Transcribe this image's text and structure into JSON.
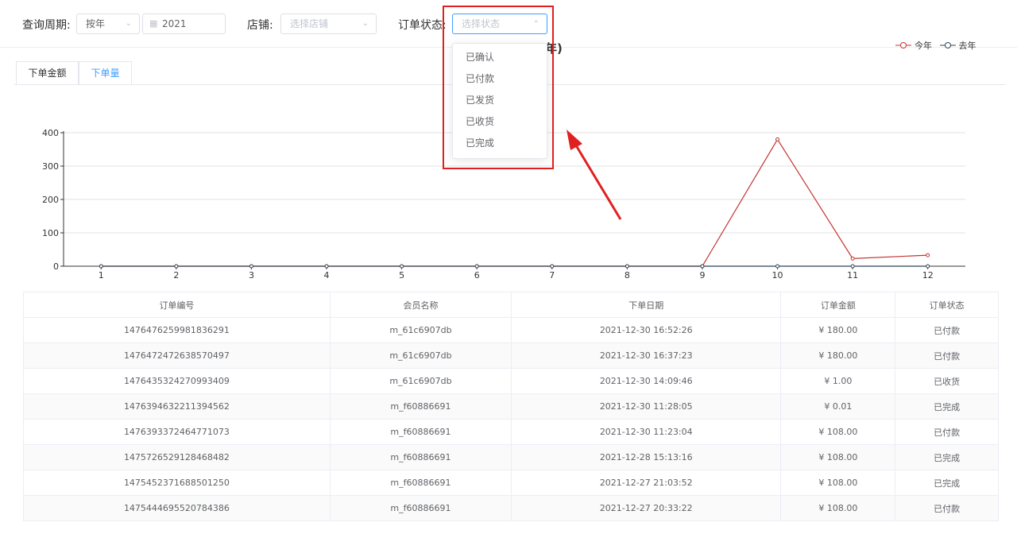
{
  "filters": {
    "period_label": "查询周期:",
    "period_value": "按年",
    "year_value": "2021",
    "shop_label": "店铺:",
    "shop_placeholder": "选择店铺",
    "status_label": "订单状态:",
    "status_placeholder": "选择状态"
  },
  "tabs": [
    {
      "label": "下单金额"
    },
    {
      "label": "下单量"
    }
  ],
  "chart_title_visible": "年)",
  "status_options": [
    "已确认",
    "已付款",
    "已发货",
    "已收货",
    "已完成"
  ],
  "chart_data": {
    "type": "line",
    "x": [
      "1",
      "2",
      "3",
      "4",
      "5",
      "6",
      "7",
      "8",
      "9",
      "10",
      "11",
      "12"
    ],
    "series": [
      {
        "name": "今年",
        "values": [
          0,
          0,
          0,
          0,
          0,
          0,
          0,
          0,
          0,
          380,
          23,
          33
        ],
        "color": "#c23531"
      },
      {
        "name": "去年",
        "values": [
          0,
          0,
          0,
          0,
          0,
          0,
          0,
          0,
          0,
          0,
          0,
          0
        ],
        "color": "#2f4554"
      }
    ],
    "yticks": [
      "0",
      "100",
      "200",
      "300",
      "400"
    ],
    "ylim": [
      0,
      400
    ],
    "legend": "top-right",
    "grid": true
  },
  "table": {
    "headers": [
      "订单编号",
      "会员名称",
      "下单日期",
      "订单金额",
      "订单状态"
    ],
    "rows": [
      [
        "1476476259981836291",
        "m_61c6907db",
        "2021-12-30 16:52:26",
        "¥ 180.00",
        "已付款"
      ],
      [
        "1476472472638570497",
        "m_61c6907db",
        "2021-12-30 16:37:23",
        "¥ 180.00",
        "已付款"
      ],
      [
        "1476435324270993409",
        "m_61c6907db",
        "2021-12-30 14:09:46",
        "¥ 1.00",
        "已收货"
      ],
      [
        "1476394632211394562",
        "m_f60886691",
        "2021-12-30 11:28:05",
        "¥ 0.01",
        "已完成"
      ],
      [
        "1476393372464771073",
        "m_f60886691",
        "2021-12-30 11:23:04",
        "¥ 108.00",
        "已付款"
      ],
      [
        "1475726529128468482",
        "m_f60886691",
        "2021-12-28 15:13:16",
        "¥ 108.00",
        "已完成"
      ],
      [
        "1475452371688501250",
        "m_f60886691",
        "2021-12-27 21:03:52",
        "¥ 108.00",
        "已完成"
      ],
      [
        "1475444695520784386",
        "m_f60886691",
        "2021-12-27 20:33:22",
        "¥ 108.00",
        "已付款"
      ]
    ]
  }
}
